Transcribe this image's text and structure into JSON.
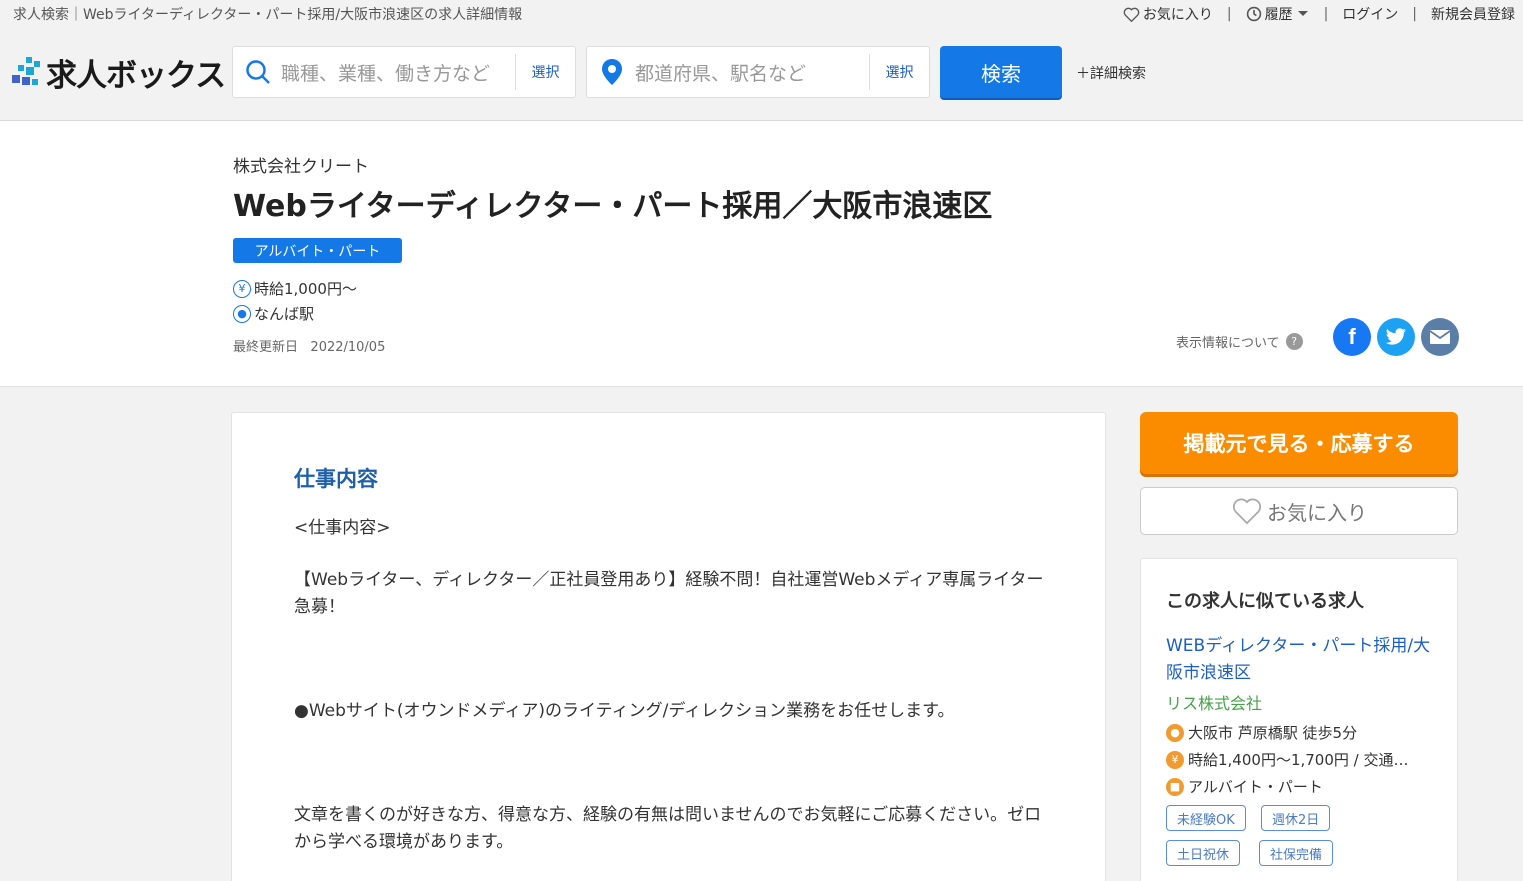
{
  "header": {
    "breadcrumb": "求人検索｜Webライターディレクター・パート採用/大阪市浪速区の求人詳細情報",
    "favorites": "お気に入り",
    "history": "履歴",
    "login": "ログイン",
    "register": "新規会員登録",
    "sep": "|",
    "logo_text": "求人ボックス",
    "keyword_placeholder": "職種、業種、働き方など",
    "keyword_select": "選択",
    "location_placeholder": "都道府県、駅名など",
    "location_select": "選択",
    "search_button": "検索",
    "detail_search": "＋詳細検索"
  },
  "job": {
    "company": "株式会社クリート",
    "title": "Webライターディレクター・パート採用／大阪市浪速区",
    "employment_type": "アルバイト・パート",
    "salary": "時給1,000円〜",
    "station": "なんば駅",
    "updated_label": "最終更新日",
    "updated_date": "2022/10/05",
    "display_info": "表示情報について"
  },
  "content": {
    "section_title": "仕事内容",
    "p1": "<仕事内容>",
    "p2": "【Webライター、ディレクター／正社員登用あり】経験不問！自社運営Webメディア専属ライター急募！",
    "p3": "●Webサイト(オウンドメディア)のライティング/ディレクション業務をお任せします。",
    "p4": "文章を書くのが好きな方、得意な方、経験の有無は問いませんのでお気軽にご応募ください。ゼロから学べる環境があります。"
  },
  "sidebar": {
    "apply_button": "掲載元で見る・応募する",
    "favorite_button": "お気に入り",
    "similar_heading": "この求人に似ている求人",
    "similar": {
      "title": "WEBディレクター・パート採用/大阪市浪速区",
      "company": "リス株式会社",
      "location": "大阪市 芦原橋駅 徒歩5分",
      "salary": "時給1,400円〜1,700円 / 交通…",
      "type": "アルバイト・パート",
      "tags": [
        "未経験OK",
        "週休2日",
        "土日祝休",
        "社保完備"
      ]
    }
  },
  "colors": {
    "primary": "#1479e6",
    "apply": "#fb8c00",
    "facebook": "#1877f2",
    "twitter": "#1da1f2",
    "mail": "#5b7ea8"
  }
}
